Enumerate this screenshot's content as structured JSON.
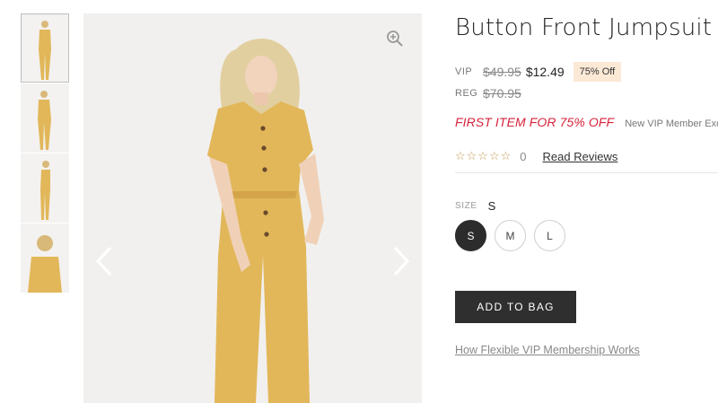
{
  "thumbnails": [
    {
      "alt": "jumpsuit-front"
    },
    {
      "alt": "jumpsuit-angle"
    },
    {
      "alt": "jumpsuit-side"
    },
    {
      "alt": "jumpsuit-closeup"
    }
  ],
  "gallery": {
    "zoom_icon": "zoom-in-icon",
    "prev_icon": "chevron-left-icon",
    "next_icon": "chevron-right-icon",
    "garment_color": "#e2b75a",
    "background_color": "#f1f0ee"
  },
  "product": {
    "title": "Button Front Jumpsuit",
    "vip_label": "VIP",
    "vip_old_price": "$49.95",
    "vip_price": "$12.49",
    "discount_badge": "75% Off",
    "reg_label": "REG",
    "reg_price": "$70.95",
    "promo": "FIRST ITEM FOR 75% OFF",
    "promo_note": "New VIP Member Exclusive",
    "stars": "☆☆☆☆☆",
    "rating_count": "0",
    "reviews_link": "Read Reviews",
    "size_label": "SIZE",
    "selected_size": "S",
    "sizes": [
      "S",
      "M",
      "L"
    ],
    "add_to_bag": "ADD TO BAG",
    "vip_link": "How Flexible VIP Membership Works"
  },
  "colors": {
    "promo_red": "#d6233b",
    "badge_bg": "#fbe9d6",
    "star_gold": "#c69a54",
    "button_dark": "#2f2f2f"
  }
}
